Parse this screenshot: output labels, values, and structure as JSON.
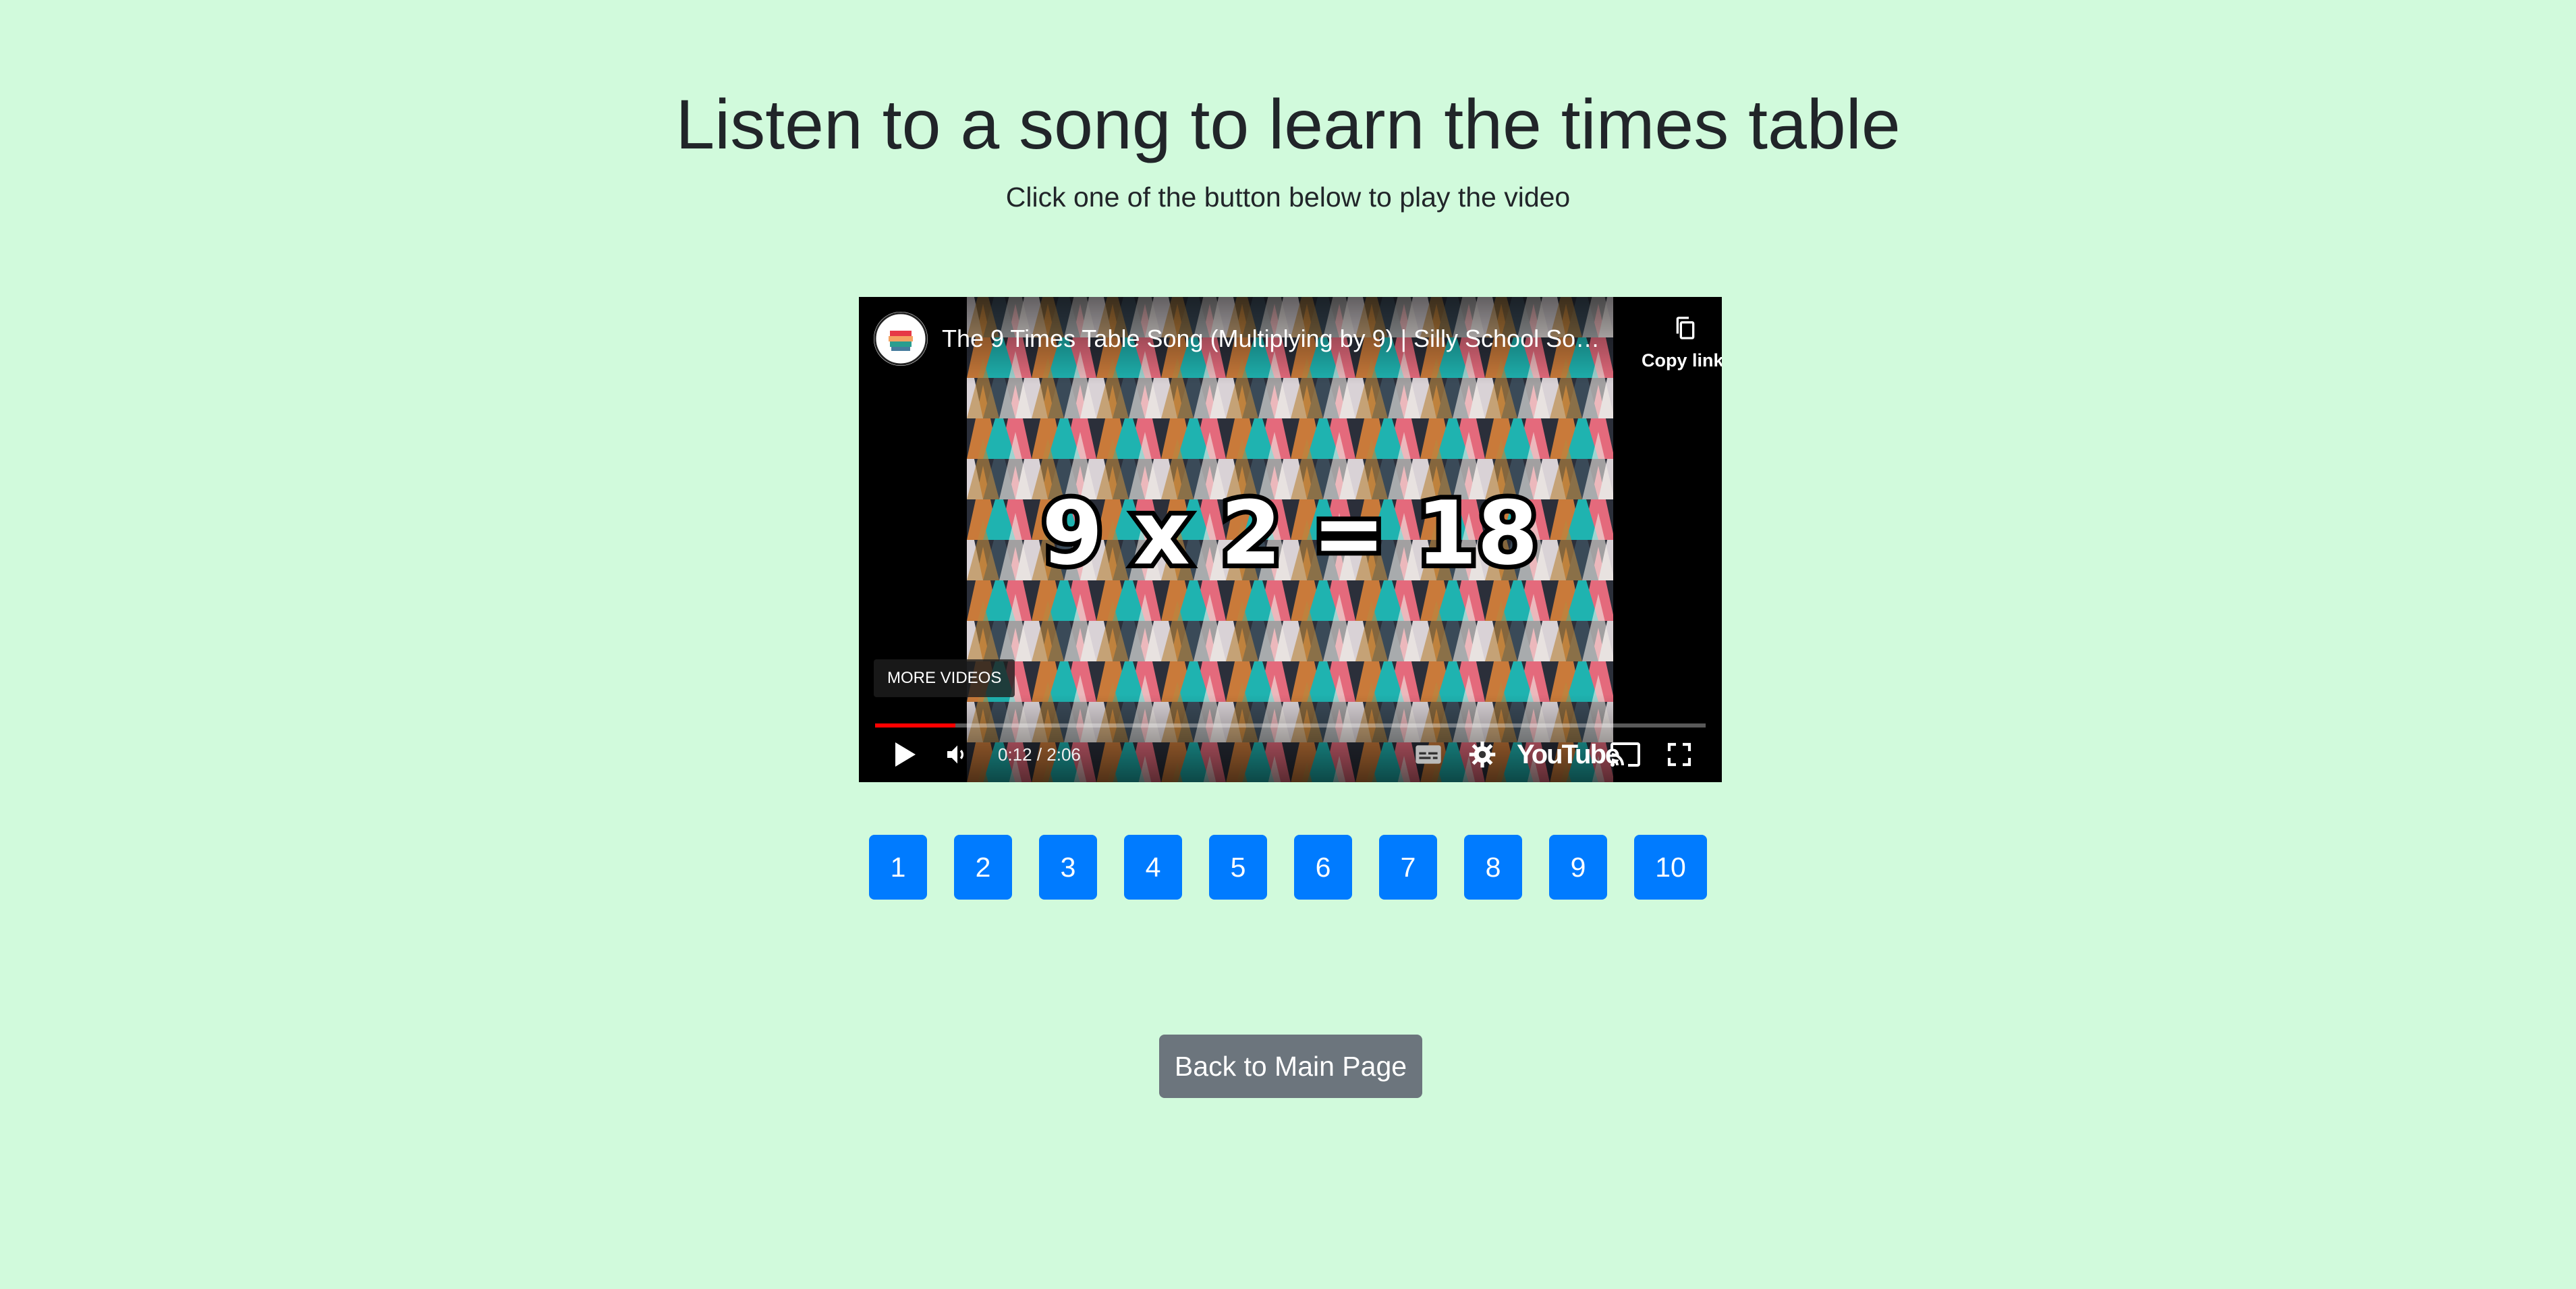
{
  "heading": "Listen to a song to learn the times table",
  "subheading": "Click one of the button below to play the video",
  "video": {
    "title": "The 9 Times Table Song (Multiplying by 9) | Silly School Son...",
    "copy_link_label": "Copy link",
    "more_videos_label": "MORE VIDEOS",
    "time_display": "0:12 / 2:06",
    "progress_fraction": 0.097,
    "frame_text": "9 x 2 = 18",
    "brand_label": "YouTube",
    "icons": [
      "play-icon",
      "volume-icon",
      "subtitles-icon",
      "settings-icon",
      "cast-icon",
      "fullscreen-icon",
      "copy-icon"
    ]
  },
  "times_buttons": [
    "1",
    "2",
    "3",
    "4",
    "5",
    "6",
    "7",
    "8",
    "9",
    "10"
  ],
  "back_button_label": "Back to Main Page",
  "colors": {
    "background": "#d1fadc",
    "primary_button": "#007bff",
    "secondary_button": "#6c757d",
    "progress": "#ff0000"
  }
}
